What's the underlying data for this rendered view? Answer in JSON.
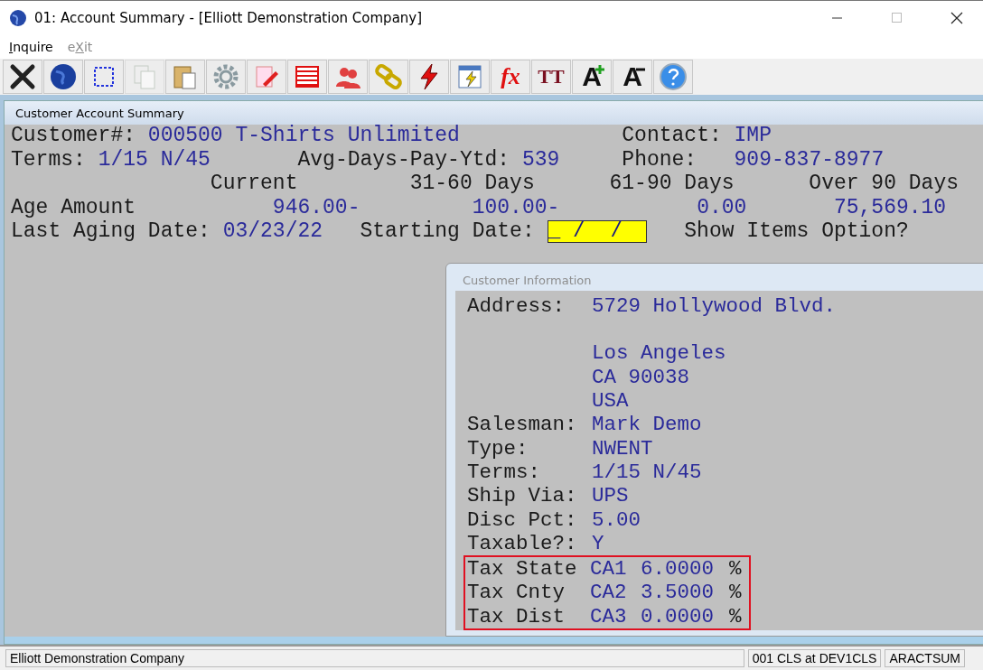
{
  "window": {
    "title": "01: Account Summary - [Elliott Demonstration Company]"
  },
  "menu": [
    {
      "accelerator": "I",
      "after": "nquire",
      "disabled": false
    },
    {
      "before": "e",
      "accelerator": "X",
      "after": "it",
      "disabled": true
    }
  ],
  "toolbar": [
    {
      "kind": "close",
      "disabled": false
    },
    {
      "kind": "globe",
      "disabled": false
    },
    {
      "kind": "select",
      "disabled": false
    },
    {
      "kind": "copy",
      "disabled": true
    },
    {
      "kind": "paste",
      "disabled": false
    },
    {
      "kind": "settings",
      "disabled": false
    },
    {
      "kind": "edit",
      "disabled": false
    },
    {
      "kind": "table",
      "disabled": false
    },
    {
      "kind": "users",
      "disabled": false
    },
    {
      "kind": "link",
      "disabled": false
    },
    {
      "kind": "lightning",
      "disabled": false
    },
    {
      "kind": "window",
      "disabled": false
    },
    {
      "kind": "formula",
      "glyph": "fx",
      "disabled": false
    },
    {
      "kind": "font",
      "glyph": "TT",
      "disabled": false
    },
    {
      "kind": "font-larger",
      "glyph": "A",
      "disabled": false
    },
    {
      "kind": "font-smaller",
      "glyph": "A",
      "disabled": false
    },
    {
      "kind": "help",
      "disabled": false
    }
  ],
  "summary": {
    "title": "Customer Account Summary",
    "header_lines": [
      [
        {
          "kind": "label",
          "text": "Customer#:"
        },
        {
          "kind": "value",
          "text": "000500 T-Shirts Unlimited"
        },
        {
          "kind": "label",
          "text": "Contact:"
        },
        {
          "kind": "value",
          "text": "IMP"
        }
      ],
      [
        {
          "kind": "label",
          "text": "Terms:"
        },
        {
          "kind": "value",
          "text": "1/15 N/45"
        },
        {
          "kind": "label",
          "text": "Avg-Days-Pay-Ytd:"
        },
        {
          "kind": "value",
          "text": "539"
        },
        {
          "kind": "label",
          "text": "Phone:"
        },
        {
          "kind": "value",
          "text": "909-837-8977"
        }
      ]
    ],
    "aging": {
      "columns": [
        "Current",
        "31-60 Days",
        "61-90 Days",
        "Over 90 Days"
      ],
      "rows": [
        {
          "label": "Age Amount",
          "values": [
            "946.00-",
            "100.00-",
            "0.00",
            "75,569.10"
          ]
        }
      ]
    },
    "footer_lines": [
      [
        {
          "kind": "label",
          "text": "Last Aging Date:"
        },
        {
          "kind": "value",
          "text": "03/23/22"
        },
        {
          "kind": "label",
          "text": "Starting Date:"
        },
        {
          "kind": "input",
          "text": "_ /  /"
        },
        {
          "kind": "label",
          "text": "Show Items Option?"
        }
      ]
    ]
  },
  "customer_info": {
    "title": "Customer Information",
    "rows": [
      {
        "kind": "field",
        "label": "Address:",
        "value": "5729 Hollywood Blvd."
      },
      {
        "kind": "blank"
      },
      {
        "kind": "field",
        "value": "Los Angeles"
      },
      {
        "kind": "field",
        "value": "CA 90038"
      },
      {
        "kind": "field",
        "value": "USA"
      },
      {
        "kind": "field",
        "label": "Salesman:",
        "value": "Mark Demo"
      },
      {
        "kind": "field",
        "label": "Type:",
        "value": "NWENT"
      },
      {
        "kind": "field",
        "label": "Terms:",
        "value": "1/15 N/45"
      },
      {
        "kind": "field",
        "label": "Ship Via:",
        "value": "UPS"
      },
      {
        "kind": "field",
        "label": "Disc Pct:",
        "value": "5.00"
      },
      {
        "kind": "field",
        "label": "Taxable?:",
        "value": "Y"
      }
    ],
    "tax": {
      "highlighted": true,
      "rows": [
        {
          "label": "Tax State",
          "code": "CA1",
          "rate": "6.0000",
          "unit": "%"
        },
        {
          "label": "Tax Cnty",
          "code": "CA2",
          "rate": "3.5000",
          "unit": "%"
        },
        {
          "label": "Tax Dist",
          "code": "CA3",
          "rate": "0.0000",
          "unit": "%"
        }
      ]
    }
  },
  "status_bar": [
    "Elliott Demonstration Company",
    "001 CLS at DEV1CLS",
    "ARACTSUM"
  ]
}
